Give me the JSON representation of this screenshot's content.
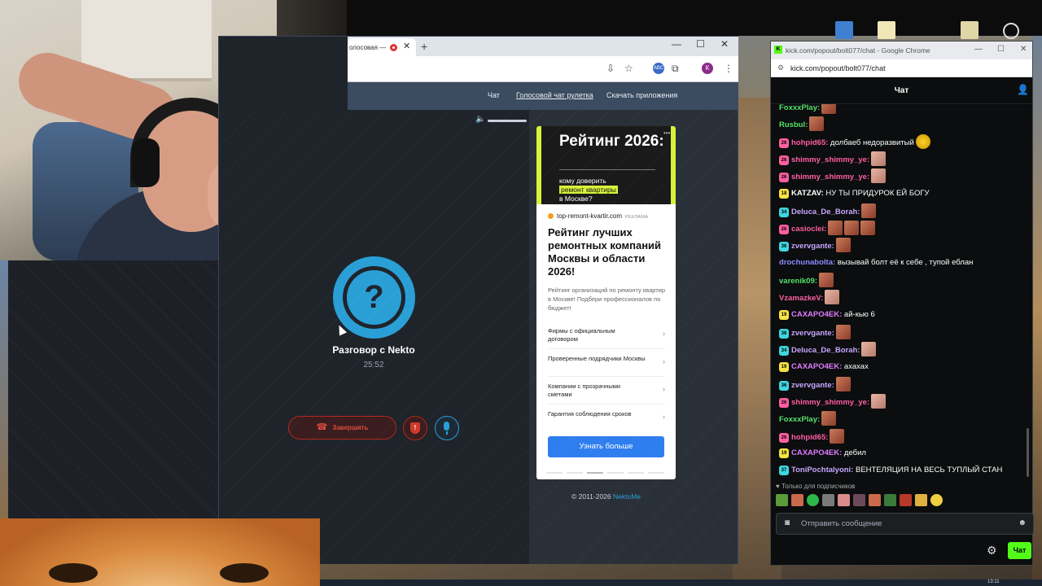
{
  "browser": {
    "tab_title": "олосовая —",
    "new_tab": "+",
    "close_tab": "✕",
    "minimize": "—",
    "maximize": "☐",
    "close": "✕",
    "profile_initial": "К",
    "ext_label": "ABC"
  },
  "site": {
    "nav": [
      "Чат",
      "Голосовой чат рулетка",
      "Скачать приложения"
    ],
    "call": {
      "avatar_glyph": "?",
      "title": "Разговор с Nekto",
      "timer": "25:52",
      "end_label": "Завершить",
      "end_icon": "☎",
      "shield_glyph": "!"
    },
    "copyright_prefix": "© 2011-2026 ",
    "copyright_brand": "NektoMe"
  },
  "ad": {
    "banner_title": "Рейтинг 2026:",
    "banner_sub_a": "кому доверить",
    "banner_sub_highlight": "ремонт квартиры",
    "banner_sub_b": "в Москве?",
    "domain": "top-remont-kvartir.com",
    "ad_mark": "РЕКЛАМА",
    "headline": "Рейтинг лучших ремонтных компаний Москвы и области 2026!",
    "description": "Рейтинг организаций по ремонту квартир в Москве! Подбери профессионалов по бюджет!",
    "items": [
      "Фирмы с официальным договором",
      "Проверенные подрядчики Москвы",
      "Компании с прозрачными сметами",
      "Гарантия соблюдения сроков"
    ],
    "cta": "Узнать больше"
  },
  "chatwin": {
    "window_title": "kick.com/popout/bolt077/chat - Google Chrome",
    "url": "kick.com/popout/bolt077/chat",
    "header": "Чат",
    "sub_only": "Только для подписчиков",
    "input_placeholder": "Отправить сообщение",
    "send_label": "Чат",
    "messages": [
      {
        "badge": "",
        "badge_color": "",
        "user": "FoxxxPlay:",
        "color": "#55e16a",
        "text": "",
        "emotes": 1
      },
      {
        "badge": "",
        "badge_color": "",
        "user": "Rusbul:",
        "color": "#55e16a",
        "text": "",
        "emotes": 1
      },
      {
        "badge": "26",
        "badge_color": "#ff5fa2",
        "user": "hohpid65:",
        "color": "#ff5fa2",
        "text": "долбаеб недоразвитый",
        "emotes": 1,
        "emote_style": "yel"
      },
      {
        "badge": "26",
        "badge_color": "#ff5fa2",
        "user": "shimmy_shimmy_ye:",
        "color": "#ff5fa2",
        "text": "",
        "emotes": 1,
        "emote_style": "pale"
      },
      {
        "badge": "26",
        "badge_color": "#ff5fa2",
        "user": "shimmy_shimmy_ye:",
        "color": "#ff5fa2",
        "text": "",
        "emotes": 1,
        "emote_style": "pale"
      },
      {
        "badge": "18",
        "badge_color": "#f5e342",
        "user": "KATZAV:",
        "color": "#ffffff",
        "text": "НУ ТЫ ПРИДУРОК ЕЙ БОГУ",
        "emotes": 0
      },
      {
        "badge": "34",
        "badge_color": "#3fd6e0",
        "user": "Deluca_De_Borah:",
        "color": "#c8a6ff",
        "text": "",
        "emotes": 1
      },
      {
        "badge": "26",
        "badge_color": "#ff5fa2",
        "user": "casioclei:",
        "color": "#ff5fa2",
        "text": "",
        "emotes": 3
      },
      {
        "badge": "36",
        "badge_color": "#3fd6e0",
        "user": "zvervgante:",
        "color": "#c8a6ff",
        "text": "",
        "emotes": 1
      },
      {
        "badge": "",
        "badge_color": "",
        "user": "drochunabolta:",
        "color": "#8a8dff",
        "text": "вызывай болт её к себе , тупой еблан",
        "emotes": 0
      },
      {
        "badge": "",
        "badge_color": "",
        "user": "varenik09:",
        "color": "#55e16a",
        "text": "",
        "emotes": 1
      },
      {
        "badge": "",
        "badge_color": "",
        "user": "VzamazkeV:",
        "color": "#ff5fa2",
        "text": "",
        "emotes": 1,
        "emote_style": "pale"
      },
      {
        "badge": "19",
        "badge_color": "#f5e342",
        "user": "CAXAPO4EK:",
        "color": "#e07bff",
        "text": "ай-кью 6",
        "emotes": 0
      },
      {
        "badge": "36",
        "badge_color": "#3fd6e0",
        "user": "zvervgante:",
        "color": "#c8a6ff",
        "text": "",
        "emotes": 1
      },
      {
        "badge": "34",
        "badge_color": "#3fd6e0",
        "user": "Deluca_De_Borah:",
        "color": "#c8a6ff",
        "text": "",
        "emotes": 1,
        "emote_style": "pale"
      },
      {
        "badge": "19",
        "badge_color": "#f5e342",
        "user": "CAXAPO4EK:",
        "color": "#e07bff",
        "text": "ахахах",
        "emotes": 0
      },
      {
        "badge": "36",
        "badge_color": "#3fd6e0",
        "user": "zvervgante:",
        "color": "#c8a6ff",
        "text": "",
        "emotes": 1
      },
      {
        "badge": "26",
        "badge_color": "#ff5fa2",
        "user": "shimmy_shimmy_ye:",
        "color": "#ff5fa2",
        "text": "",
        "emotes": 1,
        "emote_style": "pale"
      },
      {
        "badge": "",
        "badge_color": "",
        "user": "FoxxxPlay:",
        "color": "#55e16a",
        "text": "",
        "emotes": 1
      },
      {
        "badge": "26",
        "badge_color": "#ff5fa2",
        "user": "hohpid65:",
        "color": "#ff5fa2",
        "text": "",
        "emotes": 1
      },
      {
        "badge": "19",
        "badge_color": "#f5e342",
        "user": "CAXAPO4EK:",
        "color": "#e07bff",
        "text": "дебил",
        "emotes": 0
      },
      {
        "badge": "37",
        "badge_color": "#3fd6e0",
        "user": "ToniPochtalyoni:",
        "color": "#c8a6ff",
        "text": "ВЕНТЕЛЯЦИЯ НА ВЕСЬ ТУПЛЫЙ СТАН",
        "emotes": 0
      }
    ]
  },
  "taskbar": {
    "clock": "13:11"
  }
}
